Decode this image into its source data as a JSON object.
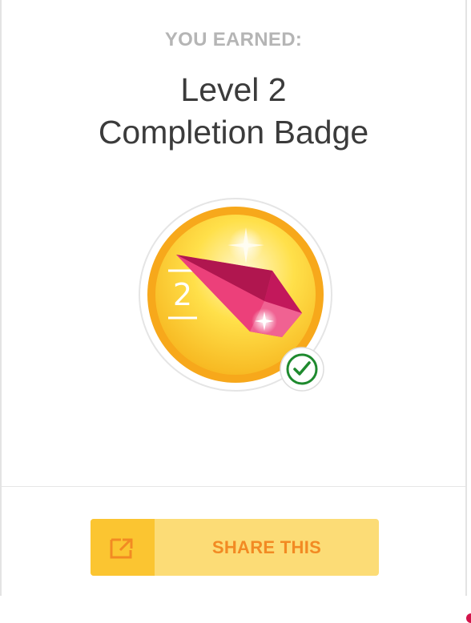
{
  "header": {
    "eyebrow": "YOU EARNED:",
    "title_line1": "Level 2",
    "title_line2": "Completion Badge"
  },
  "badge": {
    "level_number": "2",
    "icon": "crystal-gem",
    "completed": true,
    "completed_icon": "check-circle-icon",
    "colors": {
      "medal_outer": "#f7a81b",
      "medal_inner": "#ffd23a",
      "gem": "#e0256a",
      "check": "#1e8a2e"
    }
  },
  "share": {
    "label": "SHARE THIS",
    "icon": "share-external-icon",
    "colors": {
      "button_bg": "#fcdc76",
      "icon_bg": "#fbc531",
      "text": "#f28a23"
    }
  }
}
